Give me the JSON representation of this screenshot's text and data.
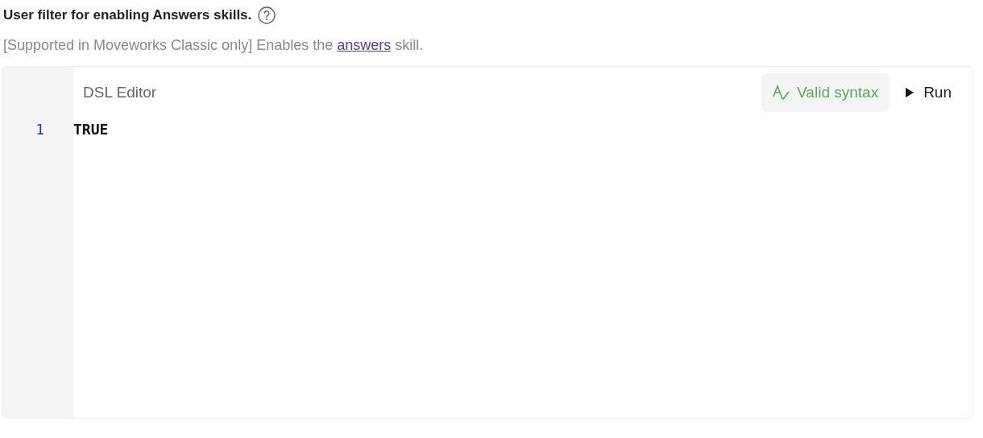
{
  "title": "User filter for enabling Answers skills.",
  "description": {
    "text": "[Supported in Moveworks Classic only] Enables the ",
    "link": "answers",
    "after": " skill."
  },
  "editor": {
    "title": "DSL Editor",
    "syntax_status": {
      "label": "Valid syntax",
      "valid": true
    },
    "run_button": "Run",
    "lines": [
      {
        "number": "1",
        "code": "TRUE"
      }
    ]
  }
}
